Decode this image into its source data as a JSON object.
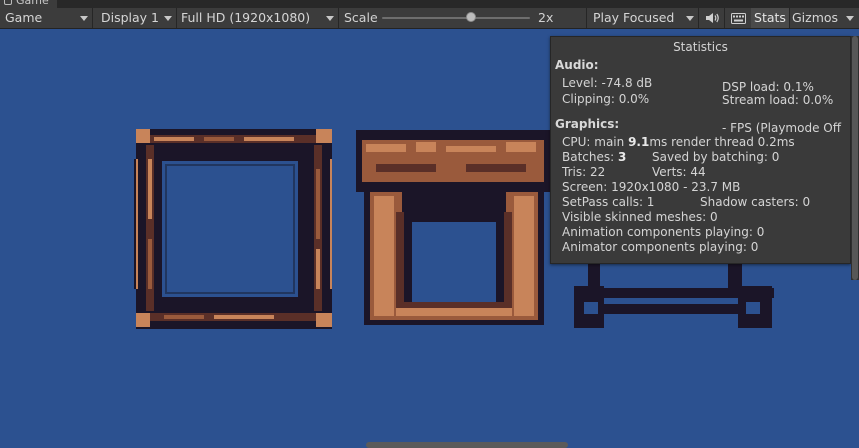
{
  "window": {
    "tab_title": "Game"
  },
  "toolbar": {
    "view_mode": "Game",
    "display": "Display 1",
    "resolution": "Full HD (1920x1080)",
    "scale_label": "Scale",
    "scale_value": "2x",
    "scale_slider_fraction": 0.6,
    "play_mode": "Play Focused",
    "stats_label": "Stats",
    "gizmos_label": "Gizmos"
  },
  "stats": {
    "title": "Statistics",
    "audio": {
      "heading": "Audio:",
      "level": "Level: -74.8 dB",
      "dsp_load": "DSP load: 0.1%",
      "clipping": "Clipping: 0.0%",
      "stream_load": "Stream load: 0.0%"
    },
    "graphics": {
      "heading": "Graphics:",
      "fps": "- FPS (Playmode Off",
      "cpu_prefix": "CPU: main ",
      "cpu_main": "9.1",
      "cpu_suffix": "ms  render thread 0.2ms",
      "batches_prefix": "Batches: ",
      "batches": "3",
      "saved_batching": "Saved by batching: 0",
      "tris": "Tris: 22",
      "verts": "Verts: 44",
      "screen": "Screen: 1920x1080 - 23.7 MB",
      "setpass": "SetPass calls: 1",
      "shadow_casters": "Shadow casters: 0",
      "skinned": "Visible skinned meshes: 0",
      "animation": "Animation components playing: 0",
      "animator": "Animator components playing: 0"
    }
  },
  "colors": {
    "background": "#2c5190",
    "toolbar": "#3c3c3c",
    "wood_light": "#c8845a",
    "wood_mid": "#9a5a3c",
    "wood_dark": "#5a2f28",
    "outline": "#1b1528"
  }
}
